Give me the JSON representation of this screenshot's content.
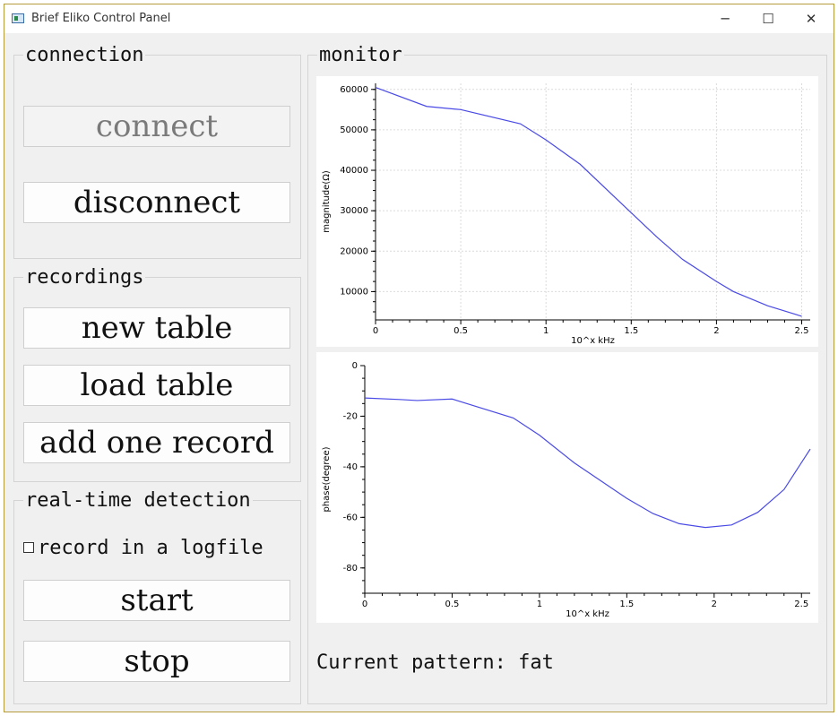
{
  "window": {
    "title": "Brief Eliko Control Panel",
    "controls": {
      "minimize": "─",
      "maximize": "☐",
      "close": "✕"
    }
  },
  "connection": {
    "title": "connection",
    "connect_label": "connect",
    "disconnect_label": "disconnect"
  },
  "recordings": {
    "title": "recordings",
    "new_table_label": "new table",
    "load_table_label": "load table",
    "add_record_label": "add one record"
  },
  "realtime": {
    "title": "real-time detection",
    "logfile_label": "record in a logfile",
    "logfile_checked": false,
    "start_label": "start",
    "stop_label": "stop"
  },
  "monitor": {
    "title": "monitor",
    "status_text": "Current pattern: fat"
  },
  "colors": {
    "line": "#4a4ae6",
    "grid": "#dcdcdc"
  },
  "chart_data": [
    {
      "type": "line",
      "xlabel": "10^x kHz",
      "ylabel": "magnitude(Ω)",
      "xlim": [
        0,
        2.55
      ],
      "ylim": [
        3000,
        61500
      ],
      "xticks": [
        0,
        0.5,
        1,
        1.5,
        2,
        2.5
      ],
      "yticks": [
        10000,
        20000,
        30000,
        40000,
        50000,
        60000
      ],
      "grid": true,
      "series": [
        {
          "x": [
            0,
            0.3,
            0.5,
            0.85,
            1.0,
            1.2,
            1.45,
            1.65,
            1.8,
            2.0,
            2.1,
            2.3,
            2.5
          ],
          "y": [
            60500,
            55800,
            55000,
            51500,
            47500,
            41500,
            31500,
            23500,
            18000,
            12500,
            10000,
            6500,
            3900
          ]
        }
      ]
    },
    {
      "type": "line",
      "xlabel": "10^x kHz",
      "ylabel": "phase(degree)",
      "xlim": [
        0,
        2.55
      ],
      "ylim": [
        -90,
        0
      ],
      "xticks": [
        0,
        0.5,
        1,
        1.5,
        2,
        2.5
      ],
      "yticks": [
        0,
        -20,
        -40,
        -60,
        -80
      ],
      "grid": false,
      "series": [
        {
          "x": [
            0,
            0.2,
            0.3,
            0.5,
            0.85,
            1.0,
            1.2,
            1.5,
            1.65,
            1.8,
            1.95,
            2.1,
            2.25,
            2.4,
            2.55
          ],
          "y": [
            -12.8,
            -13.4,
            -13.8,
            -13.2,
            -20.7,
            -27.5,
            -38.5,
            -52.5,
            -58.5,
            -62.5,
            -64.0,
            -63.0,
            -58.0,
            -49.0,
            -33.0
          ]
        }
      ]
    }
  ]
}
